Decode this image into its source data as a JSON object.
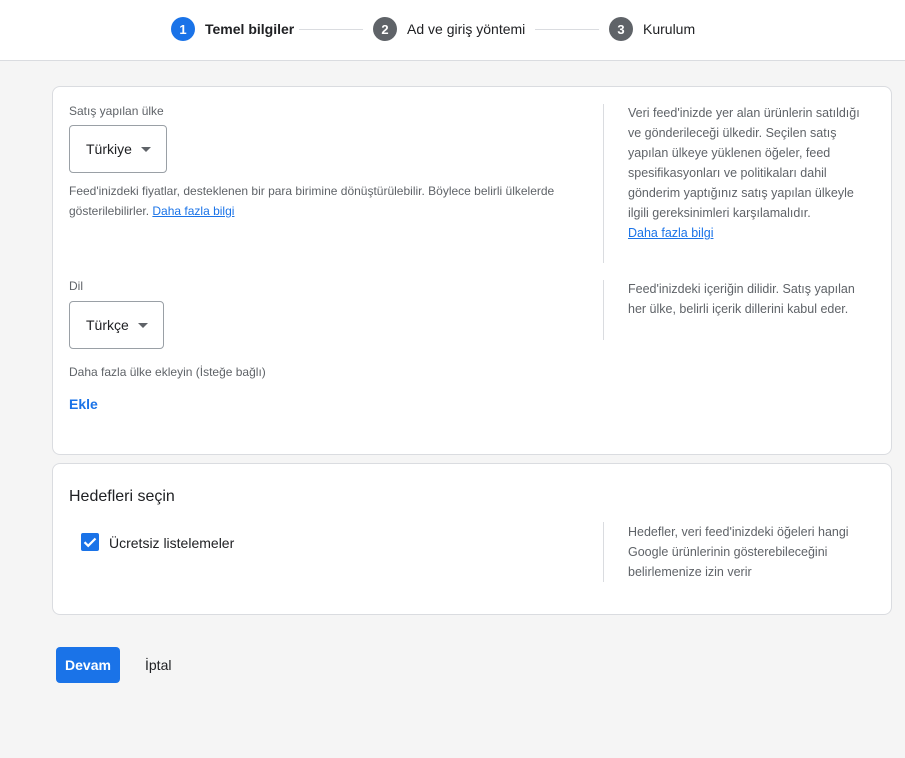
{
  "stepper": {
    "steps": [
      {
        "number": "1",
        "label": "Temel bilgiler",
        "state": "active"
      },
      {
        "number": "2",
        "label": "Ad ve giriş yöntemi",
        "state": "inactive"
      },
      {
        "number": "3",
        "label": "Kurulum",
        "state": "inactive"
      }
    ]
  },
  "country_section": {
    "label": "Satış yapılan ülke",
    "selected": "Türkiye",
    "helper": "Feed'inizdeki fiyatlar, desteklenen bir para birimine dönüştürülebilir. Böylece belirli ülkelerde gösterilebilirler.",
    "helper_link": "Daha fazla bilgi",
    "side_info": "Veri feed'inizde yer alan ürünlerin satıldığı ve gönderileceği ülkedir. Seçilen satış yapılan ülkeye yüklenen öğeler, feed spesifikasyonları ve politikaları dahil gönderim yaptığınız satış yapılan ülkeyle ilgili gereksinimleri karşılamalıdır.",
    "side_link": "Daha fazla bilgi"
  },
  "language_section": {
    "label": "Dil",
    "selected": "Türkçe",
    "side_info": "Feed'inizdeki içeriğin dilidir. Satış yapılan her ülke, belirli içerik dillerini kabul eder."
  },
  "add_country": {
    "label": "Daha fazla ülke ekleyin (İsteğe bağlı)",
    "button": "Ekle"
  },
  "destinations": {
    "title": "Hedefleri seçin",
    "option_label": "Ücretsiz listelemeler",
    "option_checked": true,
    "side_info": "Hedefler, veri feed'inizdeki öğeleri hangi Google ürünlerinin gösterebileceğini belirlemenize izin verir"
  },
  "actions": {
    "continue": "Devam",
    "cancel": "İptal"
  },
  "colors": {
    "accent": "#1a73e8",
    "inactive_step": "#5f6368",
    "background": "#f5f5f5"
  }
}
